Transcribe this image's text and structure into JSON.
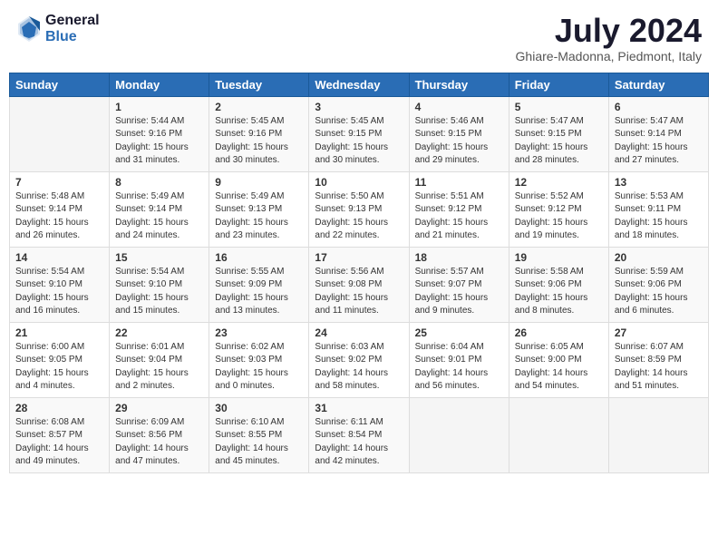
{
  "header": {
    "logo_general": "General",
    "logo_blue": "Blue",
    "month_year": "July 2024",
    "location": "Ghiare-Madonna, Piedmont, Italy"
  },
  "days_of_week": [
    "Sunday",
    "Monday",
    "Tuesday",
    "Wednesday",
    "Thursday",
    "Friday",
    "Saturday"
  ],
  "weeks": [
    [
      {
        "day": "",
        "sunrise": "",
        "sunset": "",
        "daylight": ""
      },
      {
        "day": "1",
        "sunrise": "Sunrise: 5:44 AM",
        "sunset": "Sunset: 9:16 PM",
        "daylight": "Daylight: 15 hours and 31 minutes."
      },
      {
        "day": "2",
        "sunrise": "Sunrise: 5:45 AM",
        "sunset": "Sunset: 9:16 PM",
        "daylight": "Daylight: 15 hours and 30 minutes."
      },
      {
        "day": "3",
        "sunrise": "Sunrise: 5:45 AM",
        "sunset": "Sunset: 9:15 PM",
        "daylight": "Daylight: 15 hours and 30 minutes."
      },
      {
        "day": "4",
        "sunrise": "Sunrise: 5:46 AM",
        "sunset": "Sunset: 9:15 PM",
        "daylight": "Daylight: 15 hours and 29 minutes."
      },
      {
        "day": "5",
        "sunrise": "Sunrise: 5:47 AM",
        "sunset": "Sunset: 9:15 PM",
        "daylight": "Daylight: 15 hours and 28 minutes."
      },
      {
        "day": "6",
        "sunrise": "Sunrise: 5:47 AM",
        "sunset": "Sunset: 9:14 PM",
        "daylight": "Daylight: 15 hours and 27 minutes."
      }
    ],
    [
      {
        "day": "7",
        "sunrise": "Sunrise: 5:48 AM",
        "sunset": "Sunset: 9:14 PM",
        "daylight": "Daylight: 15 hours and 26 minutes."
      },
      {
        "day": "8",
        "sunrise": "Sunrise: 5:49 AM",
        "sunset": "Sunset: 9:14 PM",
        "daylight": "Daylight: 15 hours and 24 minutes."
      },
      {
        "day": "9",
        "sunrise": "Sunrise: 5:49 AM",
        "sunset": "Sunset: 9:13 PM",
        "daylight": "Daylight: 15 hours and 23 minutes."
      },
      {
        "day": "10",
        "sunrise": "Sunrise: 5:50 AM",
        "sunset": "Sunset: 9:13 PM",
        "daylight": "Daylight: 15 hours and 22 minutes."
      },
      {
        "day": "11",
        "sunrise": "Sunrise: 5:51 AM",
        "sunset": "Sunset: 9:12 PM",
        "daylight": "Daylight: 15 hours and 21 minutes."
      },
      {
        "day": "12",
        "sunrise": "Sunrise: 5:52 AM",
        "sunset": "Sunset: 9:12 PM",
        "daylight": "Daylight: 15 hours and 19 minutes."
      },
      {
        "day": "13",
        "sunrise": "Sunrise: 5:53 AM",
        "sunset": "Sunset: 9:11 PM",
        "daylight": "Daylight: 15 hours and 18 minutes."
      }
    ],
    [
      {
        "day": "14",
        "sunrise": "Sunrise: 5:54 AM",
        "sunset": "Sunset: 9:10 PM",
        "daylight": "Daylight: 15 hours and 16 minutes."
      },
      {
        "day": "15",
        "sunrise": "Sunrise: 5:54 AM",
        "sunset": "Sunset: 9:10 PM",
        "daylight": "Daylight: 15 hours and 15 minutes."
      },
      {
        "day": "16",
        "sunrise": "Sunrise: 5:55 AM",
        "sunset": "Sunset: 9:09 PM",
        "daylight": "Daylight: 15 hours and 13 minutes."
      },
      {
        "day": "17",
        "sunrise": "Sunrise: 5:56 AM",
        "sunset": "Sunset: 9:08 PM",
        "daylight": "Daylight: 15 hours and 11 minutes."
      },
      {
        "day": "18",
        "sunrise": "Sunrise: 5:57 AM",
        "sunset": "Sunset: 9:07 PM",
        "daylight": "Daylight: 15 hours and 9 minutes."
      },
      {
        "day": "19",
        "sunrise": "Sunrise: 5:58 AM",
        "sunset": "Sunset: 9:06 PM",
        "daylight": "Daylight: 15 hours and 8 minutes."
      },
      {
        "day": "20",
        "sunrise": "Sunrise: 5:59 AM",
        "sunset": "Sunset: 9:06 PM",
        "daylight": "Daylight: 15 hours and 6 minutes."
      }
    ],
    [
      {
        "day": "21",
        "sunrise": "Sunrise: 6:00 AM",
        "sunset": "Sunset: 9:05 PM",
        "daylight": "Daylight: 15 hours and 4 minutes."
      },
      {
        "day": "22",
        "sunrise": "Sunrise: 6:01 AM",
        "sunset": "Sunset: 9:04 PM",
        "daylight": "Daylight: 15 hours and 2 minutes."
      },
      {
        "day": "23",
        "sunrise": "Sunrise: 6:02 AM",
        "sunset": "Sunset: 9:03 PM",
        "daylight": "Daylight: 15 hours and 0 minutes."
      },
      {
        "day": "24",
        "sunrise": "Sunrise: 6:03 AM",
        "sunset": "Sunset: 9:02 PM",
        "daylight": "Daylight: 14 hours and 58 minutes."
      },
      {
        "day": "25",
        "sunrise": "Sunrise: 6:04 AM",
        "sunset": "Sunset: 9:01 PM",
        "daylight": "Daylight: 14 hours and 56 minutes."
      },
      {
        "day": "26",
        "sunrise": "Sunrise: 6:05 AM",
        "sunset": "Sunset: 9:00 PM",
        "daylight": "Daylight: 14 hours and 54 minutes."
      },
      {
        "day": "27",
        "sunrise": "Sunrise: 6:07 AM",
        "sunset": "Sunset: 8:59 PM",
        "daylight": "Daylight: 14 hours and 51 minutes."
      }
    ],
    [
      {
        "day": "28",
        "sunrise": "Sunrise: 6:08 AM",
        "sunset": "Sunset: 8:57 PM",
        "daylight": "Daylight: 14 hours and 49 minutes."
      },
      {
        "day": "29",
        "sunrise": "Sunrise: 6:09 AM",
        "sunset": "Sunset: 8:56 PM",
        "daylight": "Daylight: 14 hours and 47 minutes."
      },
      {
        "day": "30",
        "sunrise": "Sunrise: 6:10 AM",
        "sunset": "Sunset: 8:55 PM",
        "daylight": "Daylight: 14 hours and 45 minutes."
      },
      {
        "day": "31",
        "sunrise": "Sunrise: 6:11 AM",
        "sunset": "Sunset: 8:54 PM",
        "daylight": "Daylight: 14 hours and 42 minutes."
      },
      {
        "day": "",
        "sunrise": "",
        "sunset": "",
        "daylight": ""
      },
      {
        "day": "",
        "sunrise": "",
        "sunset": "",
        "daylight": ""
      },
      {
        "day": "",
        "sunrise": "",
        "sunset": "",
        "daylight": ""
      }
    ]
  ]
}
